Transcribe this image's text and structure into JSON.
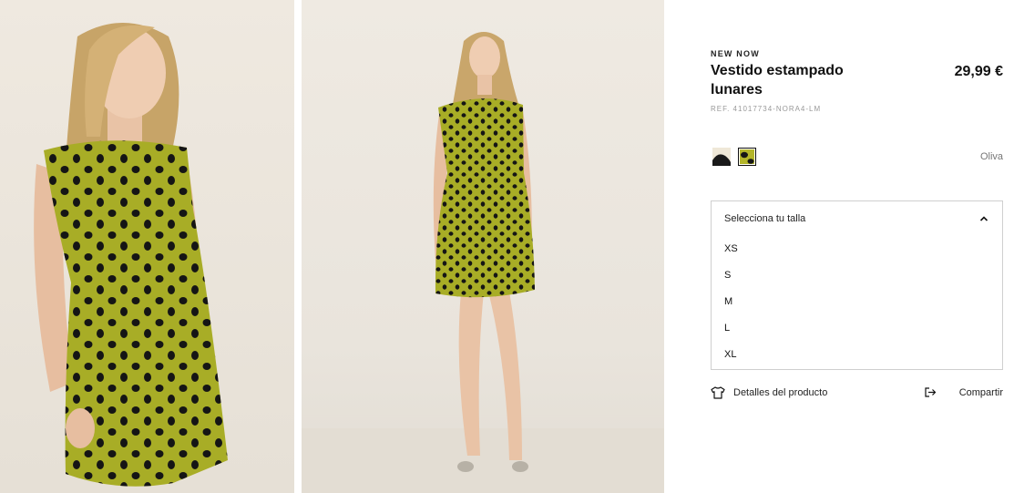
{
  "product": {
    "eyebrow": "NEW NOW",
    "title": "Vestido estampado lunares",
    "price": "29,99 €",
    "ref": "REF. 41017734-NORA4-LM"
  },
  "colors": {
    "selected_label": "Oliva",
    "swatches": [
      {
        "name": "black-cream",
        "selected": false,
        "primary": "#1a1a1a",
        "secondary": "#efe8d8"
      },
      {
        "name": "oliva",
        "selected": true,
        "primary": "#b4b62a",
        "secondary": "#161616"
      }
    ]
  },
  "size_selector": {
    "header": "Selecciona tu talla",
    "expanded": true,
    "options": [
      "XS",
      "S",
      "M",
      "L",
      "XL"
    ]
  },
  "actions": {
    "details_label": "Detalles del producto",
    "share_label": "Compartir"
  },
  "images": [
    {
      "description_icon": "model-closeup-photo"
    },
    {
      "description_icon": "model-fullbody-photo"
    }
  ],
  "theme": {
    "dress_color": "#a8ad26",
    "dot_color": "#151515",
    "background": "#ebe6dd"
  }
}
